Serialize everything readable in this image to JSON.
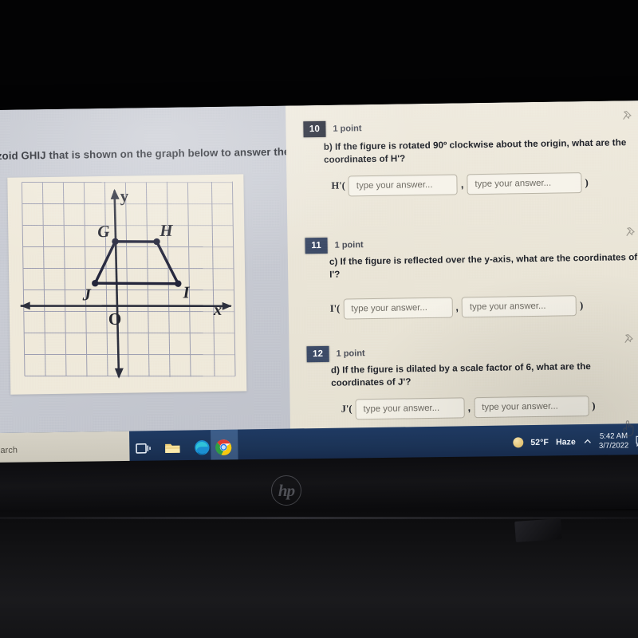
{
  "device": {
    "brand": "hp"
  },
  "left_panel": {
    "prompt": "apezoid GHIJ that is shown on the graph below to answer the"
  },
  "graph": {
    "labels": {
      "x_axis": "x",
      "y_axis": "y",
      "origin": "O",
      "g": "G",
      "h": "H",
      "i": "I",
      "j": "J"
    }
  },
  "chart_data": {
    "type": "scatter",
    "title": "",
    "xlabel": "x",
    "ylabel": "y",
    "grid": true,
    "xlim": [
      -5,
      5
    ],
    "ylim": [
      -5,
      5
    ],
    "shape": "trapezoid GHIJ",
    "points": [
      {
        "name": "G",
        "x": 0,
        "y": 3
      },
      {
        "name": "H",
        "x": 2,
        "y": 3
      },
      {
        "name": "I",
        "x": 3,
        "y": 1
      },
      {
        "name": "J",
        "x": -1,
        "y": 1
      }
    ],
    "edges": [
      [
        "G",
        "H"
      ],
      [
        "H",
        "I"
      ],
      [
        "I",
        "J"
      ],
      [
        "J",
        "G"
      ]
    ]
  },
  "questions": [
    {
      "number": "10",
      "points": "1 point",
      "text": "b)  If the figure is rotated 90º clockwise about the origin, what are the coordinates of H'?",
      "var": "H'(",
      "placeholder_1": "type your answer...",
      "placeholder_2": "type your answer...",
      "separator": ",",
      "close_paren": ")"
    },
    {
      "number": "11",
      "points": "1 point",
      "text": "c)  If the figure is reflected over the y-axis, what are the coordinates of I'?",
      "var": "I'(",
      "placeholder_1": "type your answer...",
      "placeholder_2": "type your answer...",
      "separator": ",",
      "close_paren": ")"
    },
    {
      "number": "12",
      "points": "1 point",
      "text": "d)  If the figure is dilated by a scale factor of 6, what are the coordinates of J'?",
      "var": "J'(",
      "placeholder_1": "type your answer...",
      "placeholder_2": "type your answer...",
      "separator": ",",
      "close_paren": ")"
    }
  ],
  "taskbar": {
    "search_text": "earch",
    "weather_temp": "52°F",
    "weather_cond": "Haze",
    "time": "5:42 AM",
    "date": "3/7/2022",
    "icons": [
      "task-view-icon",
      "file-explorer-icon",
      "edge-icon",
      "chrome-icon"
    ]
  }
}
